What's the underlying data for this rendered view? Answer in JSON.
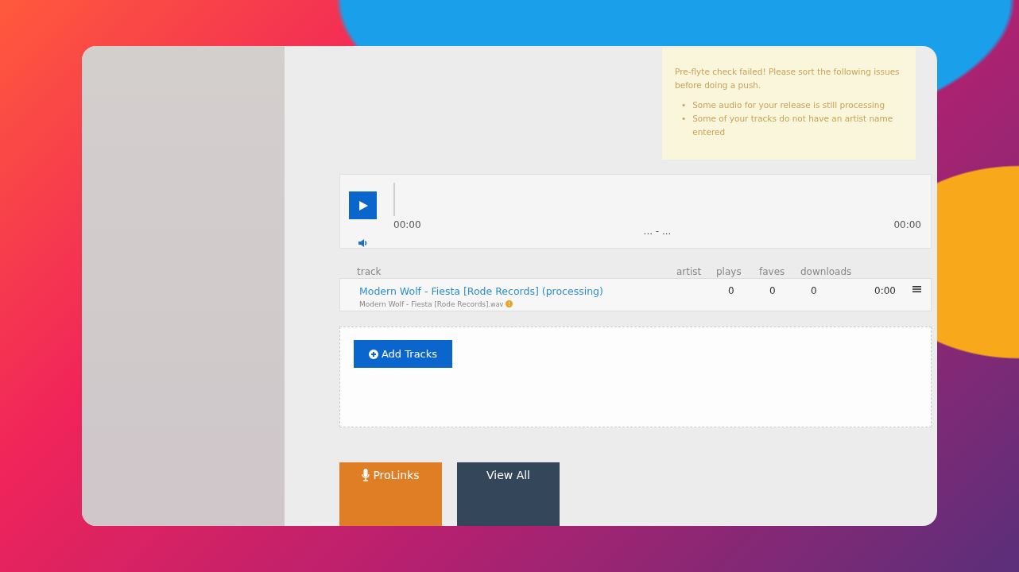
{
  "alert": {
    "message": "Pre-flyte check failed! Please sort the following issues before doing a push.",
    "issues": [
      {
        "bullet": "•",
        "text": "Some audio for your release is still processing"
      },
      {
        "bullet": "•",
        "text": "Some of your tracks do not have an artist name entered"
      }
    ]
  },
  "player": {
    "elapsed": "00:00",
    "title": "... - ...",
    "duration": "00:00"
  },
  "columns": [
    "track",
    "artist",
    "plays",
    "faves",
    "downloads"
  ],
  "tracks": [
    {
      "title": "Modern Wolf - Fiesta [Rode Records] (processing)",
      "filename": "Modern Wolf - Fiesta [Rode Records]",
      "extension": ".wav",
      "warning": true,
      "plays": "0",
      "faves": "0",
      "downloads": "0",
      "duration": "0:00"
    }
  ],
  "add_button": "Add Tracks",
  "bottom_buttons": [
    {
      "label": "ProLinks",
      "kind": "prolinks"
    },
    {
      "label": "View All",
      "kind": "view-all"
    }
  ]
}
